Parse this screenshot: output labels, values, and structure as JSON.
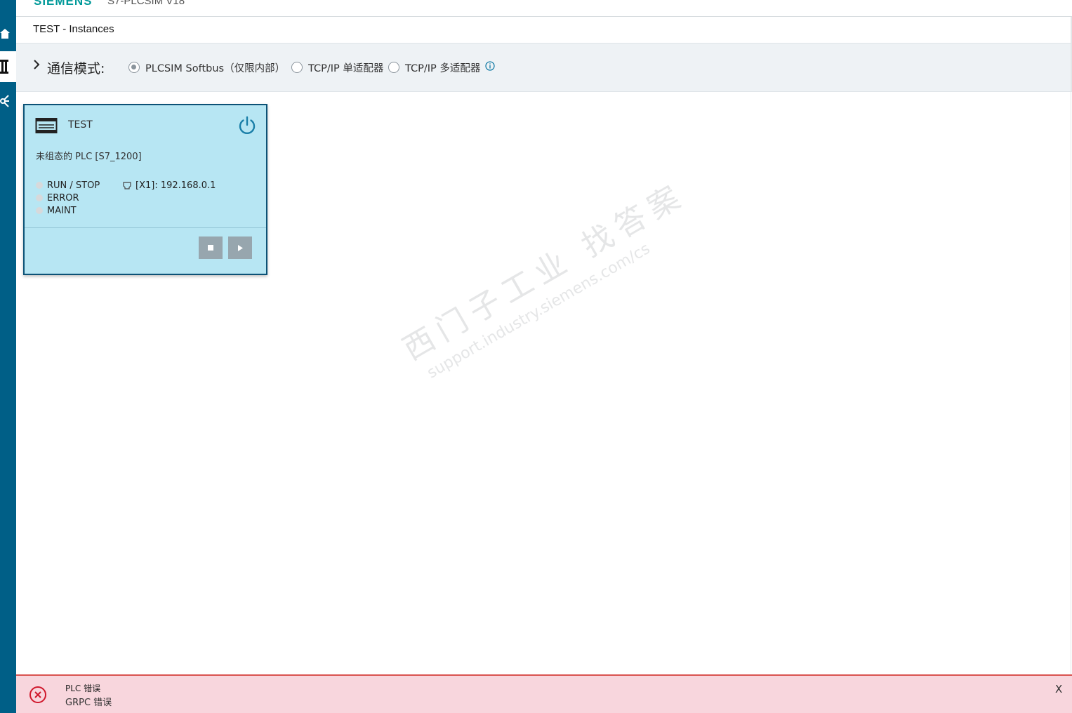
{
  "app": {
    "brand": "SIEMENS",
    "product": "S7-PLCSIM V18"
  },
  "nav": {
    "items": [
      {
        "icon": "home-icon"
      },
      {
        "icon": "instances-icon"
      },
      {
        "icon": "network-icon"
      }
    ]
  },
  "page": {
    "title": "TEST - Instances"
  },
  "comm_mode": {
    "label": "通信模式:",
    "options": [
      {
        "label": "PLCSIM Softbus（仅限内部）",
        "selected": true
      },
      {
        "label": "TCP/IP 单适配器",
        "selected": false
      },
      {
        "label": "TCP/IP 多适配器",
        "selected": false
      }
    ],
    "info_icon": "info-icon"
  },
  "instance": {
    "name": "TEST",
    "description": "未组态的 PLC [S7_1200]",
    "leds": [
      {
        "label": "RUN / STOP"
      },
      {
        "label": "ERROR"
      },
      {
        "label": "MAINT"
      }
    ],
    "ip": "[X1]: 192.168.0.1",
    "colors": {
      "card_bg": "#b7e6f3",
      "border": "#0c5276",
      "power": "#1a7fa8"
    }
  },
  "watermark": {
    "cn": "西门子工业  找答案",
    "url": "support.industry.siemens.com/cs"
  },
  "toast": {
    "title": "PLC 错误",
    "message": "GRPC 错误",
    "close": "X"
  }
}
